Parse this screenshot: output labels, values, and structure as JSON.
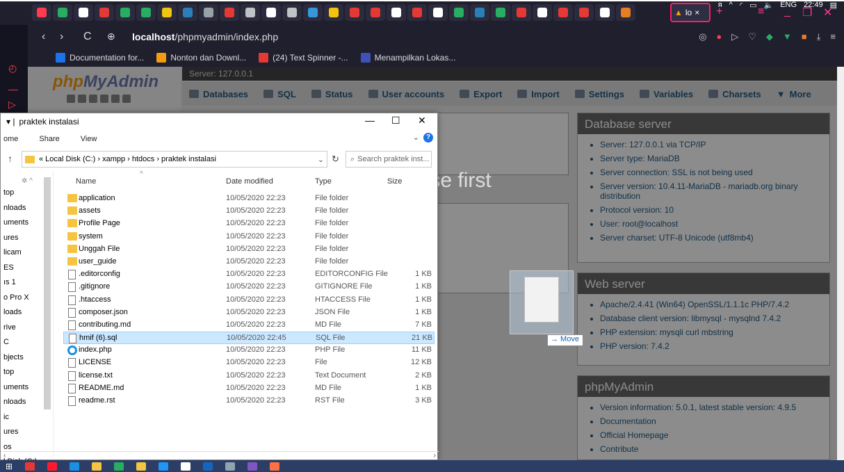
{
  "browser": {
    "active_tab_label": "lo",
    "url_host": "localhost",
    "url_path": "/phpmyadmin/index.php",
    "bookmarks": [
      {
        "label": "Documentation for...",
        "color": "#1a73e8"
      },
      {
        "label": "Nonton dan Downl...",
        "color": "#f39c12"
      },
      {
        "label": "(24) Text Spinner -...",
        "color": "#e53935"
      },
      {
        "label": "Menampilkan Lokas...",
        "color": "#3f51b5"
      }
    ],
    "tab_favicon_colors": [
      "#ff3b4d",
      "#27ae60",
      "#ffffff",
      "#e53935",
      "#27ae60",
      "#27ae60",
      "#f1c40f",
      "#2980b9",
      "#95a5a6",
      "#e53935",
      "#bdc3c7",
      "#ffffff",
      "#bdc3c7",
      "#3498db",
      "#f1c40f",
      "#e53935",
      "#e53935",
      "#ffffff",
      "#e53935",
      "#ffffff",
      "#27ae60",
      "#2980b9",
      "#27ae60",
      "#e53935",
      "#ffffff",
      "#e53935",
      "#e53935",
      "#ffffff",
      "#e67e22"
    ]
  },
  "pma": {
    "logo_php": "php",
    "logo_myadmin": "MyAdmin",
    "server_bar": "Server: 127.0.0.1",
    "menu": [
      "Databases",
      "SQL",
      "Status",
      "User accounts",
      "Export",
      "Import",
      "Settings",
      "Variables",
      "Charsets",
      "More"
    ],
    "background_text": "base first",
    "db_server": {
      "title": "Database server",
      "items": [
        "Server: 127.0.0.1 via TCP/IP",
        "Server type: MariaDB",
        "Server connection: SSL is not being used",
        "Server version: 10.4.11-MariaDB - mariadb.org binary distribution",
        "Protocol version: 10",
        "User: root@localhost",
        "Server charset: UTF-8 Unicode (utf8mb4)"
      ]
    },
    "web_server": {
      "title": "Web server",
      "items": [
        "Apache/2.4.41 (Win64) OpenSSL/1.1.1c PHP/7.4.2",
        "Database client version: libmysql - mysqlnd 7.4.2",
        "PHP extension: mysqli  curl  mbstring",
        "PHP version: 7.4.2"
      ]
    },
    "pma_info": {
      "title": "phpMyAdmin",
      "items": [
        "Version information: 5.0.1, latest stable version: 4.9.5",
        "Documentation",
        "Official Homepage",
        "Contribute"
      ]
    }
  },
  "explorer": {
    "title": "praktek instalasi",
    "ribbon": [
      "ome",
      "Share",
      "View"
    ],
    "breadcrumb": "«  Local Disk (C:)  ›  xampp  ›  htdocs  ›  praktek instalasi",
    "search_placeholder": "Search praktek inst...",
    "headers": {
      "name": "Name",
      "date": "Date modified",
      "type": "Type",
      "size": "Size"
    },
    "nav_items": [
      "top",
      "nloads",
      "uments",
      "ures",
      "licam",
      "ES",
      "ıs 1",
      "o Pro X",
      "loads",
      "rive",
      "C",
      "bjects",
      "top",
      "uments",
      "nloads",
      "ic",
      "ures",
      "os",
      "l Disk (C:)"
    ],
    "files": [
      {
        "name": "application",
        "date": "10/05/2020 22:23",
        "type": "File folder",
        "size": "",
        "kind": "folder"
      },
      {
        "name": "assets",
        "date": "10/05/2020 22:23",
        "type": "File folder",
        "size": "",
        "kind": "folder"
      },
      {
        "name": "Profile Page",
        "date": "10/05/2020 22:23",
        "type": "File folder",
        "size": "",
        "kind": "folder"
      },
      {
        "name": "system",
        "date": "10/05/2020 22:23",
        "type": "File folder",
        "size": "",
        "kind": "folder"
      },
      {
        "name": "Unggah File",
        "date": "10/05/2020 22:23",
        "type": "File folder",
        "size": "",
        "kind": "folder"
      },
      {
        "name": "user_guide",
        "date": "10/05/2020 22:23",
        "type": "File folder",
        "size": "",
        "kind": "folder"
      },
      {
        "name": ".editorconfig",
        "date": "10/05/2020 22:23",
        "type": "EDITORCONFIG File",
        "size": "1 KB",
        "kind": "file"
      },
      {
        "name": ".gitignore",
        "date": "10/05/2020 22:23",
        "type": "GITIGNORE File",
        "size": "1 KB",
        "kind": "file"
      },
      {
        "name": ".htaccess",
        "date": "10/05/2020 22:23",
        "type": "HTACCESS File",
        "size": "1 KB",
        "kind": "file"
      },
      {
        "name": "composer.json",
        "date": "10/05/2020 22:23",
        "type": "JSON File",
        "size": "1 KB",
        "kind": "file"
      },
      {
        "name": "contributing.md",
        "date": "10/05/2020 22:23",
        "type": "MD File",
        "size": "7 KB",
        "kind": "file"
      },
      {
        "name": "hmif (6).sql",
        "date": "10/05/2020 22:45",
        "type": "SQL File",
        "size": "21 KB",
        "kind": "file",
        "selected": true
      },
      {
        "name": "index.php",
        "date": "10/05/2020 22:23",
        "type": "PHP File",
        "size": "11 KB",
        "kind": "ie"
      },
      {
        "name": "LICENSE",
        "date": "10/05/2020 22:23",
        "type": "File",
        "size": "12 KB",
        "kind": "file"
      },
      {
        "name": "license.txt",
        "date": "10/05/2020 22:23",
        "type": "Text Document",
        "size": "2 KB",
        "kind": "file"
      },
      {
        "name": "README.md",
        "date": "10/05/2020 22:23",
        "type": "MD File",
        "size": "1 KB",
        "kind": "file"
      },
      {
        "name": "readme.rst",
        "date": "10/05/2020 22:23",
        "type": "RST File",
        "size": "3 KB",
        "kind": "file"
      }
    ]
  },
  "drag": {
    "label": "→ Move"
  },
  "taskbar": {
    "time": "22:49",
    "lang": "ENG",
    "icon_colors": [
      "#e53935",
      "#ff1b2d",
      "#1a8fe3",
      "#f5c542",
      "#27ae60",
      "#f5c542",
      "#2196f3",
      "#ffffff",
      "#1565c0",
      "#90a4ae",
      "#7e57c2",
      "#ff7043"
    ]
  }
}
